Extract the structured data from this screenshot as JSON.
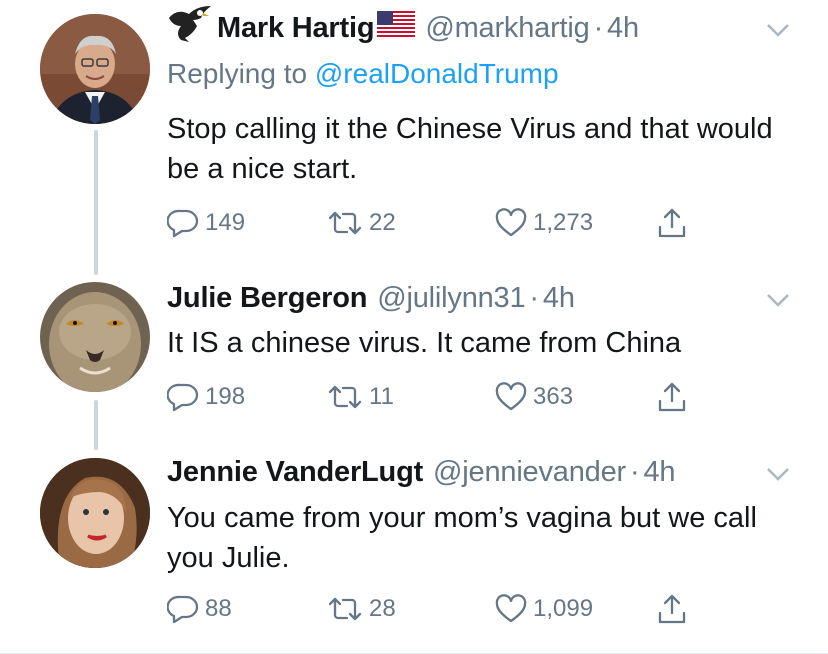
{
  "thread": [
    {
      "author_name": "Mark Hartig",
      "handle": "@markhartig",
      "time": "4h",
      "dot": "·",
      "replying_prefix": "Replying to",
      "replying_to": "@realDonaldTrump",
      "text": "Stop calling it the Chinese Virus and that would be a nice start.",
      "replies": "149",
      "retweets": "22",
      "likes": "1,273"
    },
    {
      "author_name": "Julie Bergeron",
      "handle": "@julilynn31",
      "time": "4h",
      "dot": "·",
      "text": "It IS a chinese virus. It came from China",
      "replies": "198",
      "retweets": "11",
      "likes": "363"
    },
    {
      "author_name": "Jennie VanderLugt",
      "handle": "@jennievander",
      "time": "4h",
      "dot": "·",
      "text": "You came from your mom’s vagina but we call you Julie.",
      "replies": "88",
      "retweets": "28",
      "likes": "1,099"
    }
  ],
  "colors": {
    "primary_text": "#14171a",
    "secondary_text": "#657786",
    "link": "#1da1f2",
    "thread_line": "#ccd6dd"
  },
  "icons": [
    "eagle-icon",
    "us-flag-icon",
    "chevron-down-icon",
    "reply-icon",
    "retweet-icon",
    "like-icon",
    "share-icon"
  ]
}
